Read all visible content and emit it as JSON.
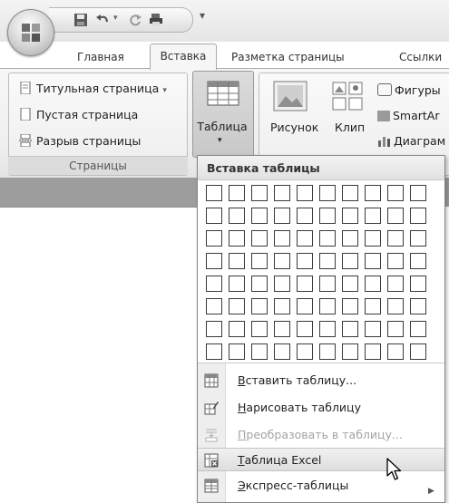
{
  "tabs": {
    "home": "Главная",
    "insert": "Вставка",
    "layout": "Разметка страницы",
    "links": "Ссылки"
  },
  "pages_group": {
    "items": [
      "Титульная страница",
      "Пустая страница",
      "Разрыв страницы"
    ],
    "label": "Страницы"
  },
  "table_button": {
    "label": "Таблица"
  },
  "illustrations": {
    "picture": "Рисунок",
    "clip": "Клип",
    "shapes": "Фигуры",
    "smartart": "SmartAr",
    "chart": "Диаграм"
  },
  "insert_table_menu": {
    "header": "Вставка таблицы",
    "grid_columns": 10,
    "grid_rows": 8,
    "items": [
      {
        "underline": "В",
        "rest": "ставить таблицу...",
        "icon": "insert-table-icon",
        "enabled": true
      },
      {
        "underline": "Н",
        "rest": "арисовать таблицу",
        "icon": "draw-table-icon",
        "enabled": true
      },
      {
        "underline": "П",
        "rest": "реобразовать в таблицу...",
        "icon": "convert-table-icon",
        "enabled": false
      },
      {
        "underline": "Т",
        "rest": "аблица Excel",
        "icon": "excel-table-icon",
        "enabled": true,
        "highlighted": true
      },
      {
        "underline": "Э",
        "rest": "кспресс-таблицы",
        "icon": "quick-tables-icon",
        "enabled": true,
        "submenu": true
      }
    ]
  },
  "colors": {
    "ribbon_bg": "#efefef",
    "menu_border": "#868686",
    "grid_stroke": "#3a3a3a",
    "disabled_text": "#a3a3a3"
  }
}
